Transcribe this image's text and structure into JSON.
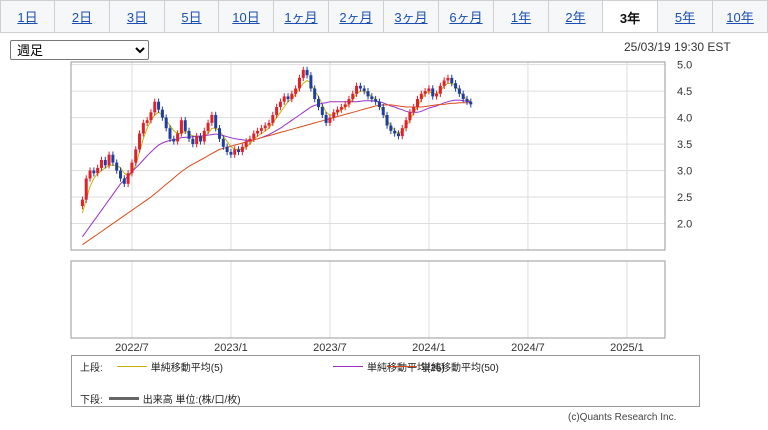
{
  "tabs": [
    "1日",
    "2日",
    "3日",
    "5日",
    "10日",
    "1ヶ月",
    "2ヶ月",
    "3ヶ月",
    "6ヶ月",
    "1年",
    "2年",
    "3年",
    "5年",
    "10年"
  ],
  "active_tab_index": 11,
  "period_select": {
    "value": "週足"
  },
  "timestamp": "25/03/19 19:30 EST",
  "colors": {
    "up": "#e0202a",
    "down": "#1f3fa0",
    "ma5": "#c8b400",
    "ma25": "#9b30c8",
    "ma50": "#d94c1a",
    "grid": "#dddddd"
  },
  "legend": {
    "upper_label": "上段:",
    "lower_label": "下段:",
    "ma5": "単純移動平均(5)",
    "ma25": "単純移動平均(25)",
    "ma50": "単純移動平均(50)",
    "volume": "出来高 単位:(株/口/枚)"
  },
  "credit": "(c)Quants Research Inc.",
  "chart_data": {
    "type": "candlestick",
    "y_ticks": [
      "5.0",
      "4.5",
      "4.0",
      "3.5",
      "3.0",
      "2.5",
      "2.0"
    ],
    "ylim": [
      1.5,
      5.05
    ],
    "x_ticks": [
      {
        "label": "2022/7",
        "week": 13
      },
      {
        "label": "2023/1",
        "week": 39
      },
      {
        "label": "2023/7",
        "week": 65
      },
      {
        "label": "2024/1",
        "week": 91
      },
      {
        "label": "2024/7",
        "week": 117
      },
      {
        "label": "2025/1",
        "week": 143
      }
    ],
    "x_range": [
      -3,
      153
    ],
    "start_week": 0,
    "closes": [
      2.45,
      2.85,
      3.0,
      2.95,
      3.05,
      3.2,
      3.1,
      3.3,
      3.15,
      3.0,
      2.85,
      2.75,
      2.95,
      3.15,
      3.4,
      3.7,
      3.9,
      3.95,
      4.1,
      4.3,
      4.15,
      4.0,
      3.8,
      3.6,
      3.55,
      3.7,
      3.95,
      3.75,
      3.6,
      3.5,
      3.65,
      3.55,
      3.75,
      3.9,
      4.05,
      3.8,
      3.6,
      3.45,
      3.35,
      3.3,
      3.4,
      3.35,
      3.45,
      3.55,
      3.6,
      3.7,
      3.75,
      3.8,
      3.85,
      3.9,
      4.05,
      4.2,
      4.3,
      4.4,
      4.35,
      4.45,
      4.55,
      4.75,
      4.9,
      4.8,
      4.55,
      4.35,
      4.2,
      4.05,
      3.9,
      4.0,
      4.1,
      4.15,
      4.2,
      4.25,
      4.35,
      4.45,
      4.6,
      4.55,
      4.5,
      4.4,
      4.35,
      4.3,
      4.2,
      4.05,
      3.85,
      3.75,
      3.7,
      3.65,
      3.8,
      3.95,
      4.1,
      4.2,
      4.35,
      4.45,
      4.5,
      4.55,
      4.4,
      4.45,
      4.6,
      4.7,
      4.75,
      4.65,
      4.55,
      4.45,
      4.35,
      4.3,
      4.25
    ],
    "series": [
      {
        "name": "単純移動平均(5)",
        "color": "#c8b400",
        "values": [
          2.2,
          2.45,
          2.7,
          2.85,
          2.95,
          3.0,
          3.05,
          3.1,
          3.1,
          3.1,
          3.05,
          2.95,
          2.9,
          2.95,
          3.1,
          3.35,
          3.6,
          3.8,
          3.95,
          4.05,
          4.1,
          4.05,
          3.95,
          3.85,
          3.75,
          3.7,
          3.7,
          3.75,
          3.7,
          3.65,
          3.65,
          3.6,
          3.65,
          3.7,
          3.8,
          3.8,
          3.75,
          3.65,
          3.55,
          3.45,
          3.4,
          3.4,
          3.4,
          3.45,
          3.5,
          3.6,
          3.65,
          3.7,
          3.75,
          3.8,
          3.9,
          4.0,
          4.1,
          4.2,
          4.3,
          4.35,
          4.45,
          4.55,
          4.65,
          4.7,
          4.65,
          4.5,
          4.4,
          4.25,
          4.1,
          4.05,
          4.05,
          4.1,
          4.15,
          4.2,
          4.25,
          4.35,
          4.45,
          4.5,
          4.5,
          4.45,
          4.4,
          4.35,
          4.25,
          4.1,
          3.95,
          3.85,
          3.75,
          3.7,
          3.75,
          3.85,
          3.95,
          4.1,
          4.2,
          4.35,
          4.45,
          4.5,
          4.45,
          4.45,
          4.5,
          4.6,
          4.65,
          4.65,
          4.6,
          4.5,
          4.4,
          4.35,
          4.3
        ]
      },
      {
        "name": "単純移動平均(25)",
        "color": "#9b30c8",
        "values": [
          1.75,
          1.85,
          1.95,
          2.05,
          2.15,
          2.25,
          2.35,
          2.45,
          2.55,
          2.65,
          2.75,
          2.82,
          2.9,
          2.98,
          3.05,
          3.12,
          3.2,
          3.28,
          3.35,
          3.42,
          3.48,
          3.52,
          3.55,
          3.57,
          3.58,
          3.6,
          3.62,
          3.63,
          3.63,
          3.64,
          3.65,
          3.65,
          3.66,
          3.67,
          3.68,
          3.69,
          3.68,
          3.66,
          3.64,
          3.62,
          3.6,
          3.59,
          3.58,
          3.57,
          3.57,
          3.58,
          3.6,
          3.62,
          3.65,
          3.68,
          3.72,
          3.76,
          3.8,
          3.85,
          3.9,
          3.95,
          4.0,
          4.05,
          4.1,
          4.15,
          4.2,
          4.23,
          4.25,
          4.27,
          4.28,
          4.3,
          4.3,
          4.3,
          4.3,
          4.3,
          4.3,
          4.3,
          4.3,
          4.31,
          4.32,
          4.32,
          4.32,
          4.31,
          4.3,
          4.28,
          4.25,
          4.22,
          4.2,
          4.17,
          4.15,
          4.12,
          4.1,
          4.1,
          4.1,
          4.12,
          4.15,
          4.18,
          4.2,
          4.22,
          4.25,
          4.28,
          4.3,
          4.32,
          4.33,
          4.33,
          4.32,
          4.31,
          4.3
        ]
      },
      {
        "name": "単純移動平均(50)",
        "color": "#d94c1a",
        "values": [
          1.6,
          1.65,
          1.7,
          1.75,
          1.8,
          1.85,
          1.9,
          1.95,
          2.0,
          2.05,
          2.1,
          2.15,
          2.2,
          2.25,
          2.3,
          2.35,
          2.4,
          2.45,
          2.5,
          2.56,
          2.62,
          2.68,
          2.74,
          2.8,
          2.86,
          2.92,
          2.98,
          3.03,
          3.08,
          3.12,
          3.16,
          3.2,
          3.24,
          3.28,
          3.32,
          3.36,
          3.4,
          3.42,
          3.44,
          3.46,
          3.48,
          3.5,
          3.52,
          3.54,
          3.56,
          3.58,
          3.6,
          3.62,
          3.64,
          3.66,
          3.68,
          3.7,
          3.72,
          3.74,
          3.76,
          3.78,
          3.8,
          3.82,
          3.84,
          3.86,
          3.88,
          3.9,
          3.92,
          3.94,
          3.96,
          3.98,
          4.0,
          4.02,
          4.04,
          4.06,
          4.08,
          4.1,
          4.12,
          4.14,
          4.16,
          4.18,
          4.2,
          4.22,
          4.23,
          4.24,
          4.24,
          4.24,
          4.23,
          4.22,
          4.21,
          4.2,
          4.2,
          4.2,
          4.2,
          4.2,
          4.21,
          4.22,
          4.23,
          4.24,
          4.25,
          4.25,
          4.26,
          4.27,
          4.27,
          4.28,
          4.28,
          4.28,
          4.28
        ]
      }
    ]
  }
}
